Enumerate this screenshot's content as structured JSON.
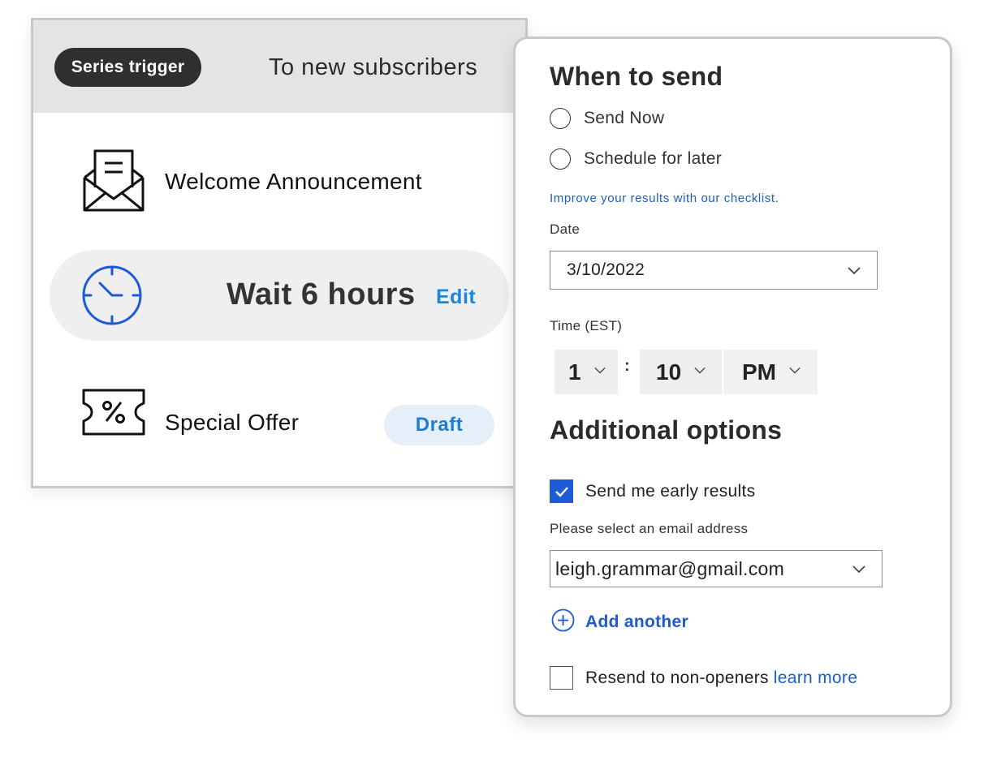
{
  "series": {
    "trigger_label": "Series trigger",
    "audience": "To new subscribers",
    "steps": [
      {
        "icon": "envelope-open-icon",
        "title": "Welcome Announcement"
      },
      {
        "icon": "clock-icon",
        "title": "Wait 6 hours",
        "action": "Edit"
      },
      {
        "icon": "coupon-percent-icon",
        "title": "Special Offer",
        "badge": "Draft"
      }
    ]
  },
  "send_panel": {
    "heading": "When to send",
    "options": [
      "Send Now",
      "Schedule for later"
    ],
    "checklist_link": "Improve your results with our checklist.",
    "date_label": "Date",
    "date_value": "3/10/2022",
    "time_label": "Time (EST)",
    "time_hour": "1",
    "time_separator": ":",
    "time_minute": "10",
    "time_period": "PM",
    "additional_heading": "Additional options",
    "early_results_label": "Send me early results",
    "early_results_checked": true,
    "email_prompt": "Please select an email address",
    "email_value": "leigh.grammar@gmail.com",
    "add_another": "Add another",
    "resend_label": "Resend to non-openers",
    "resend_checked": false,
    "learn_more": "learn more"
  },
  "colors": {
    "accent_blue": "#1c5ad8",
    "link_blue": "#1a86d9",
    "dark_pill": "#2f2f2f",
    "header_gray": "#e4e4e4"
  }
}
